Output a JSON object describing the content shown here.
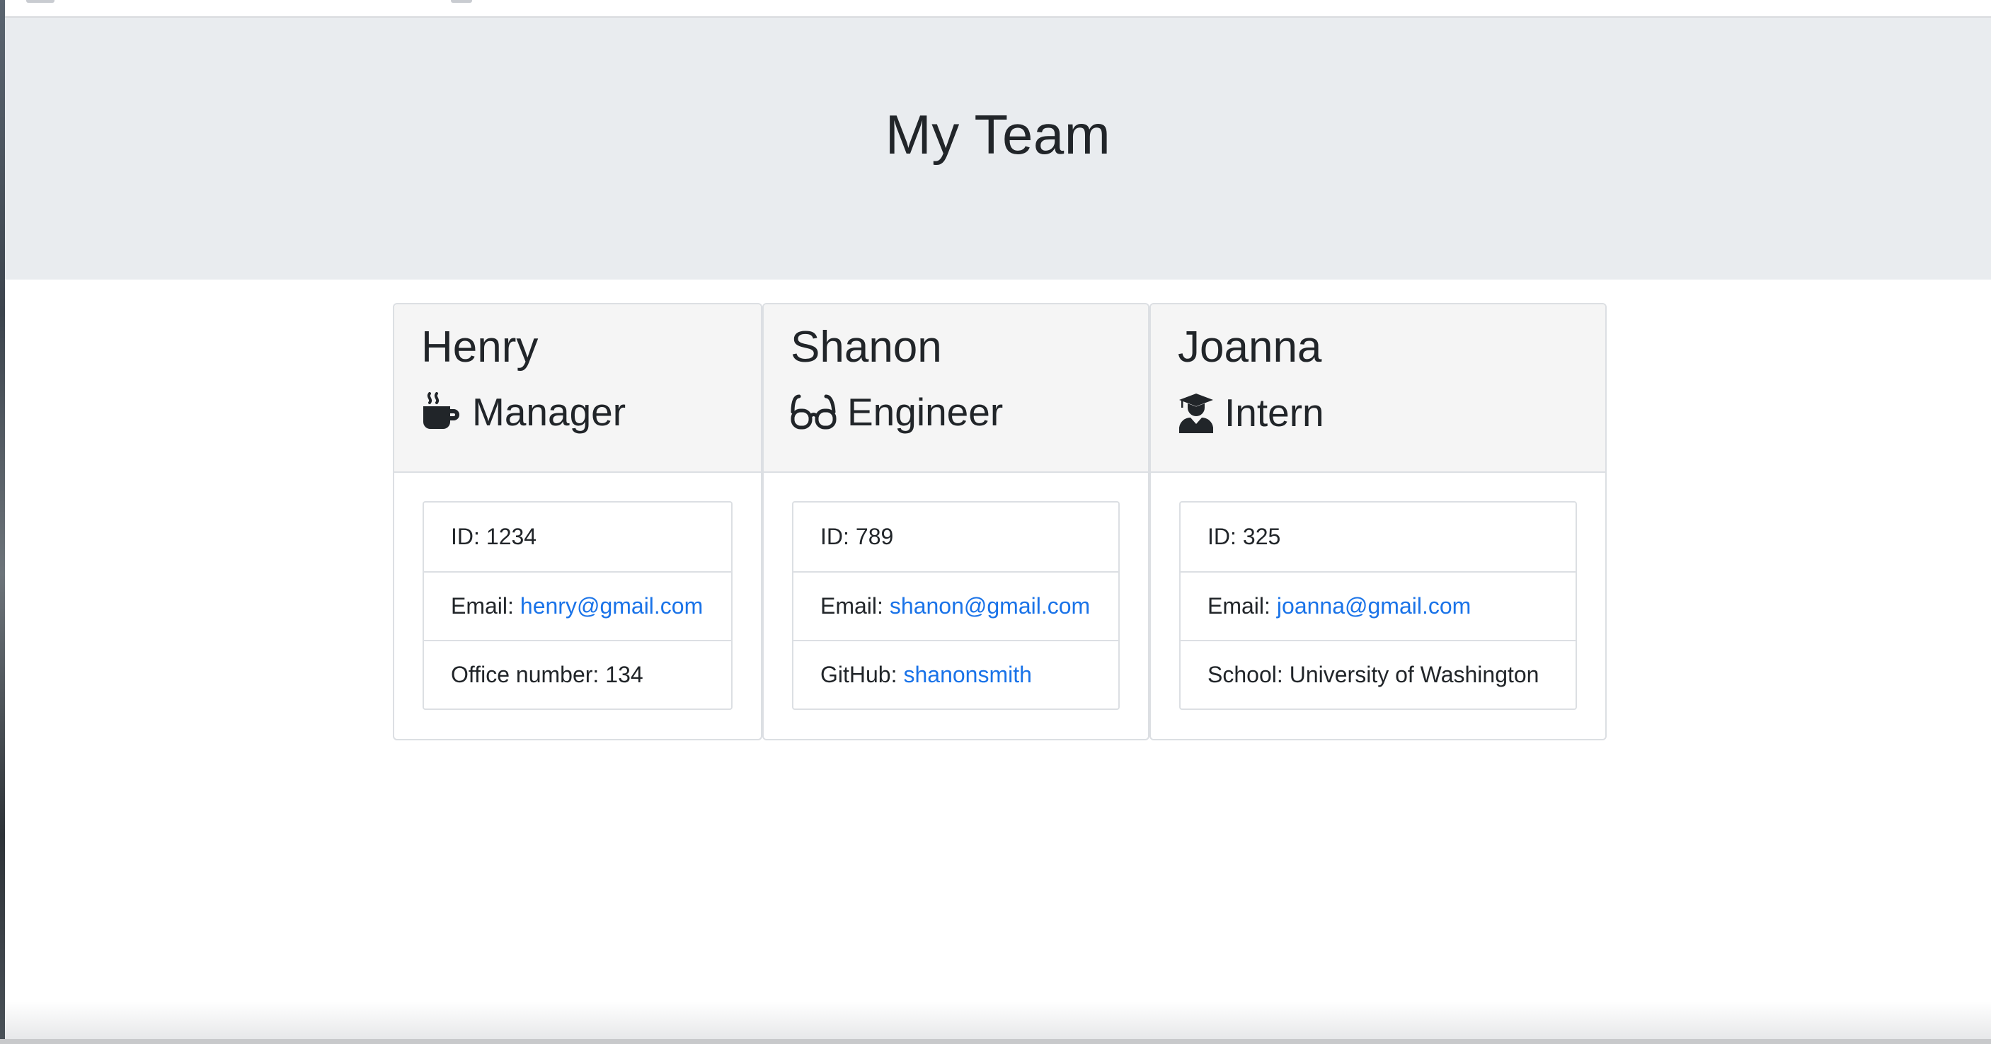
{
  "header": {
    "title": "My Team"
  },
  "employees": [
    {
      "name": "Henry",
      "role": "Manager",
      "icon": "coffee-icon",
      "id_label": "ID:",
      "id": "1234",
      "email_label": "Email:",
      "email": "henry@gmail.com",
      "extra_label": "Office number:",
      "extra_value": "134",
      "extra_is_link": false
    },
    {
      "name": "Shanon",
      "role": "Engineer",
      "icon": "glasses-icon",
      "id_label": "ID:",
      "id": "789",
      "email_label": "Email:",
      "email": "shanon@gmail.com",
      "extra_label": "GitHub:",
      "extra_value": "shanonsmith",
      "extra_is_link": true
    },
    {
      "name": "Joanna",
      "role": "Intern",
      "icon": "graduate-icon",
      "id_label": "ID:",
      "id": "325",
      "email_label": "Email:",
      "email": "joanna@gmail.com",
      "extra_label": "School:",
      "extra_value": "University of Washington",
      "extra_is_link": false
    }
  ],
  "colors": {
    "jumbotron_bg": "#e9ecef",
    "card_header_bg": "#f5f5f5",
    "link": "#1a73e8",
    "text": "#212529"
  }
}
